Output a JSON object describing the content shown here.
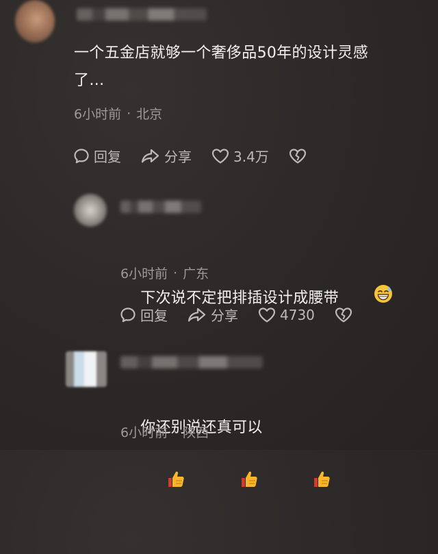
{
  "comments": [
    {
      "text": "一个五金店就够一个奢侈品50年的设计灵感\n了…",
      "time": "6小时前",
      "location": "北京",
      "reply_label": "回复",
      "share_label": "分享",
      "likes": "3.4万"
    },
    {
      "text": "下次说不定把排插设计成腰带",
      "time": "6小时前",
      "location": "广东",
      "reply_label": "回复",
      "share_label": "分享",
      "likes": "4730"
    },
    {
      "text": "你还别说还真可以",
      "time": "6小时前",
      "location": "陕西"
    }
  ],
  "meta_separator": "·",
  "icons": [
    "reply-bubble-icon",
    "share-arrow-icon",
    "heart-icon",
    "broken-heart-icon",
    "grinning-sweat-emoji-icon",
    "thumbs-up-emoji-icon"
  ],
  "colors": {
    "background": "#2b2827",
    "text": "#f2f1ef",
    "meta": "#9d9a98",
    "action": "#bdbab8"
  }
}
